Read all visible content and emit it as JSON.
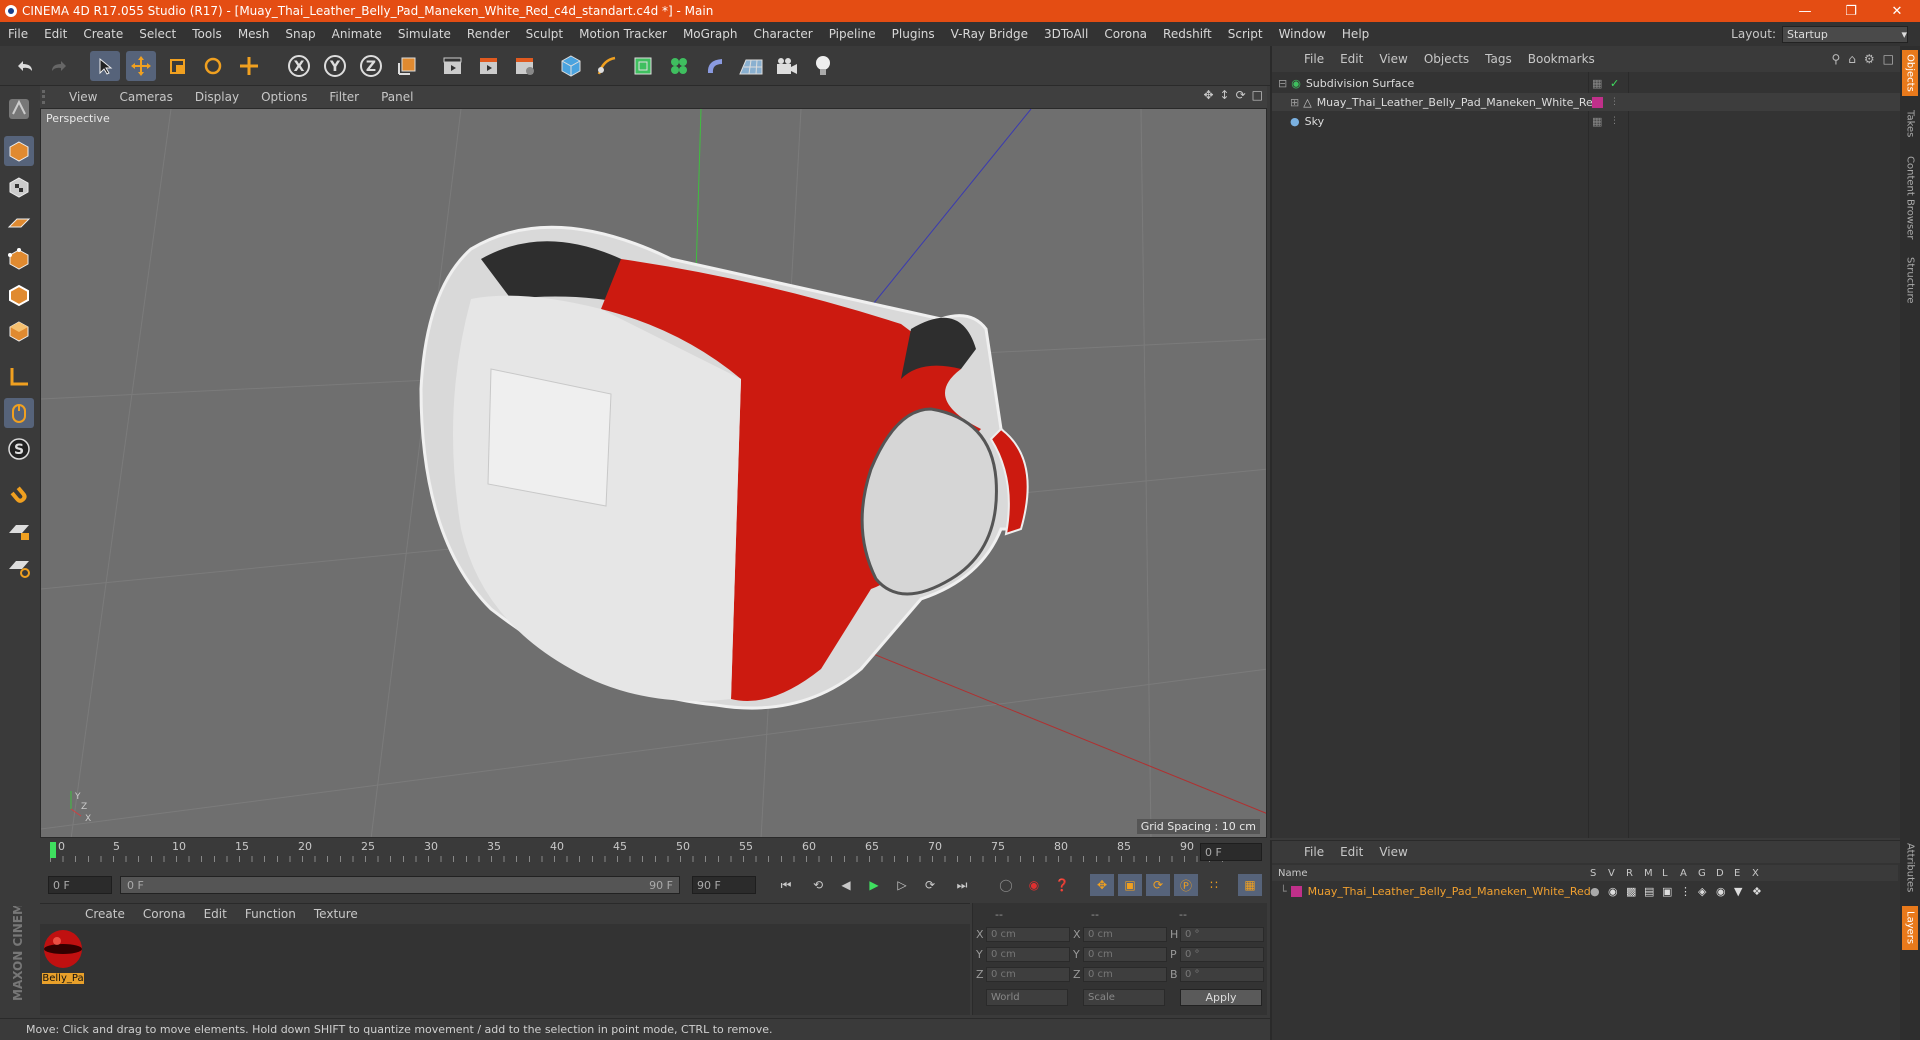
{
  "window": {
    "title": "CINEMA 4D R17.055 Studio (R17) - [Muay_Thai_Leather_Belly_Pad_Maneken_White_Red_c4d_standart.c4d *] - Main"
  },
  "menubar": {
    "items": [
      "File",
      "Edit",
      "Create",
      "Select",
      "Tools",
      "Mesh",
      "Snap",
      "Animate",
      "Simulate",
      "Render",
      "Sculpt",
      "Motion Tracker",
      "MoGraph",
      "Character",
      "Pipeline",
      "Plugins",
      "V-Ray Bridge",
      "3DToAll",
      "Corona",
      "Redshift",
      "Script",
      "Window",
      "Help"
    ],
    "layout_label": "Layout:",
    "layout_value": "Startup"
  },
  "viewport": {
    "menu": [
      "View",
      "Cameras",
      "Display",
      "Options",
      "Filter",
      "Panel"
    ],
    "label": "Perspective",
    "grid_spacing": "Grid Spacing : 10 cm"
  },
  "timeline": {
    "ticks": [
      "0",
      "5",
      "10",
      "15",
      "20",
      "25",
      "30",
      "35",
      "40",
      "45",
      "50",
      "55",
      "60",
      "65",
      "70",
      "75",
      "80",
      "85",
      "90"
    ],
    "end_field": "0 F"
  },
  "transport": {
    "start": "0 F",
    "range_start": "0 F",
    "range_end": "90 F",
    "end": "90 F"
  },
  "materials": {
    "menu": [
      "Create",
      "Corona",
      "Edit",
      "Function",
      "Texture"
    ],
    "swatch_label": "Belly_Pa"
  },
  "coords": {
    "headers": [
      "--",
      "--",
      "--"
    ],
    "rows": [
      {
        "a": "X",
        "av": "0 cm",
        "b": "X",
        "bv": "0 cm",
        "c": "H",
        "cv": "0 °"
      },
      {
        "a": "Y",
        "av": "0 cm",
        "b": "Y",
        "bv": "0 cm",
        "c": "P",
        "cv": "0 °"
      },
      {
        "a": "Z",
        "av": "0 cm",
        "b": "Z",
        "bv": "0 cm",
        "c": "B",
        "cv": "0 °"
      }
    ],
    "mode1": "World",
    "mode2": "Scale",
    "apply": "Apply"
  },
  "objects": {
    "menu": [
      "File",
      "Edit",
      "View",
      "Objects",
      "Tags",
      "Bookmarks"
    ],
    "items": [
      "Subdivision Surface",
      "Muay_Thai_Leather_Belly_Pad_Maneken_White_Red",
      "Sky"
    ]
  },
  "layers": {
    "menu": [
      "File",
      "Edit",
      "View"
    ],
    "name_header": "Name",
    "cols": [
      "S",
      "V",
      "R",
      "M",
      "L",
      "A",
      "G",
      "D",
      "E",
      "X"
    ],
    "row": "Muay_Thai_Leather_Belly_Pad_Maneken_White_Red"
  },
  "right_tabs": [
    "Objects",
    "Takes",
    "Content Browser",
    "Structure",
    "Attributes",
    "Layers"
  ],
  "brand": "MAXON CINEMA 4D",
  "status": "Move: Click and drag to move elements. Hold down SHIFT to quantize movement / add to the selection in point mode, CTRL to remove.",
  "colors": {
    "titlebar": "#e44d13",
    "accent": "#e8791b",
    "layer_color": "#c0308a",
    "highlight_text": "#f0a030"
  }
}
